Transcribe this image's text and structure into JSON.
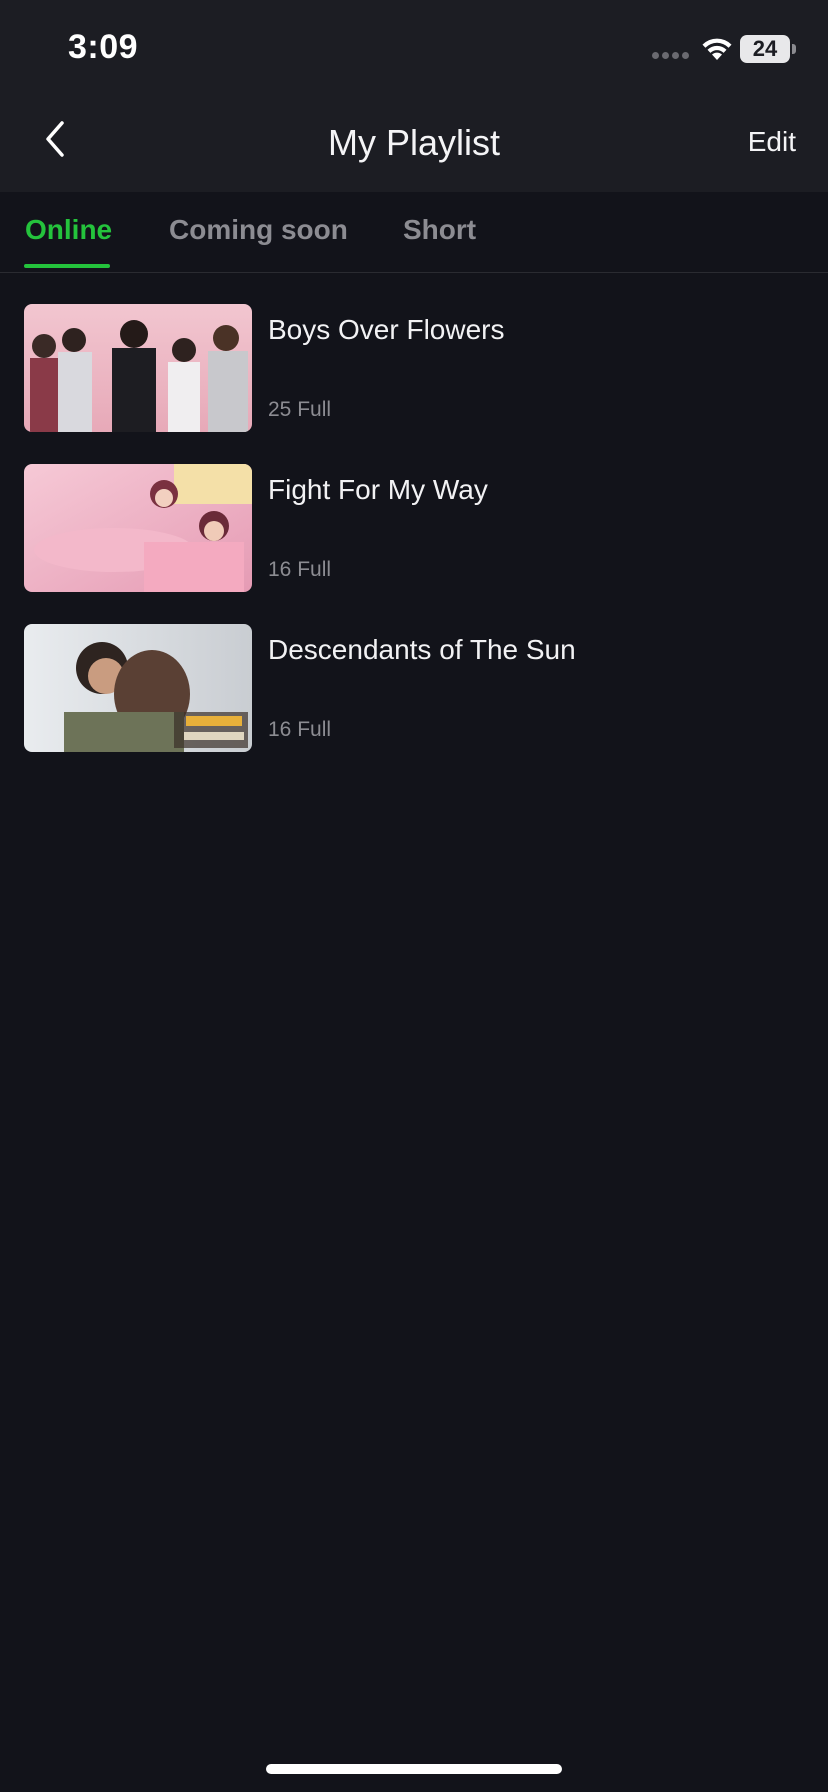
{
  "status_bar": {
    "time": "3:09",
    "battery": "24"
  },
  "header": {
    "back_icon": "chevron-left-icon",
    "title": "My Playlist",
    "edit_label": "Edit"
  },
  "tabs": [
    {
      "label": "Online",
      "active": true
    },
    {
      "label": "Coming soon",
      "active": false
    },
    {
      "label": "Short",
      "active": false
    }
  ],
  "playlist": [
    {
      "title": "Boys Over Flowers",
      "episodes": "25 Full"
    },
    {
      "title": "Fight For My Way",
      "episodes": "16 Full"
    },
    {
      "title": "Descendants of The Sun",
      "episodes": "16 Full"
    }
  ],
  "colors": {
    "accent": "#24c33c",
    "background": "#12131a",
    "header_background": "#1c1d23"
  }
}
